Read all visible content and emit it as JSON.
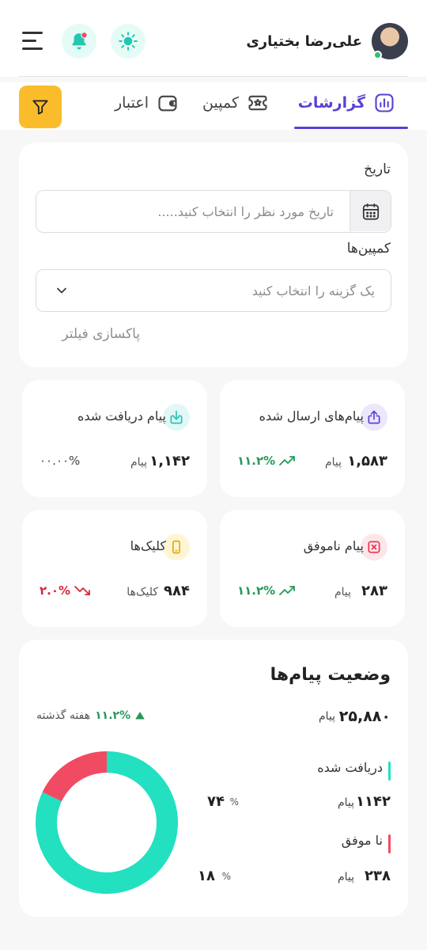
{
  "header": {
    "user_name": "علی‌رضا بختیاری",
    "theme_icon": "sun-icon",
    "notification_icon": "bell-icon",
    "menu_icon": "hamburger-icon"
  },
  "tabs": [
    {
      "label": "گزارشات",
      "icon": "chart-icon",
      "active": true
    },
    {
      "label": "کمپین",
      "icon": "ticket-icon",
      "active": false
    },
    {
      "label": "اعتبار",
      "icon": "wallet-icon",
      "active": false
    }
  ],
  "filters": {
    "date_label": "تاریخ",
    "date_placeholder": "تاریخ مورد نظر را انتخاب کنید.....",
    "campaign_label": "کمپین‌ها",
    "campaign_placeholder": "یک گزینه را انتخاب کنید",
    "clear_label": "پاکسازی فیلتر"
  },
  "stats": {
    "sent": {
      "title": "پیام‌های ارسال شده",
      "value": "۱,۵۸۳",
      "unit": "پیام",
      "change": "۱۱.۲%",
      "trend": "up"
    },
    "received": {
      "title": "پیام دریافت شده",
      "value": "۱,۱۴۲",
      "unit": "پیام",
      "change": "۰۰.۰۰%",
      "trend": "none"
    },
    "failed": {
      "title": "پیام ناموفق",
      "value": "۲۸۳",
      "unit": "پیام",
      "change": "۱۱.۲%",
      "trend": "up"
    },
    "clicks": {
      "title": "کلیک‌ها",
      "value": "۹۸۴",
      "unit": "کلیک‌ها",
      "change": "۲.۰%",
      "trend": "down"
    }
  },
  "status": {
    "title": "وضعیت پیام‌ها",
    "total_value": "۲۵,۸۸۰",
    "total_unit": "پیام",
    "week_change": "۱۱.۲%",
    "week_label": "هفته گذشته",
    "items": [
      {
        "label": "دریافت شده",
        "value": "۱۱۴۲",
        "unit": "پیام",
        "percent": "۷۴",
        "pct_sign": "%",
        "color": "#22e0c0"
      },
      {
        "label": "نا موفق",
        "value": "۲۳۸",
        "unit": "پیام",
        "percent": "۱۸",
        "pct_sign": "%",
        "color": "#f04b63"
      }
    ]
  },
  "chart_data": {
    "type": "pie",
    "categories": [
      "دریافت شده",
      "نا موفق"
    ],
    "values": [
      82,
      18
    ]
  },
  "colors": {
    "accent": "#5b3fd6",
    "filter_button": "#fbbc2c",
    "up": "#25995a",
    "down": "#d6263b"
  }
}
